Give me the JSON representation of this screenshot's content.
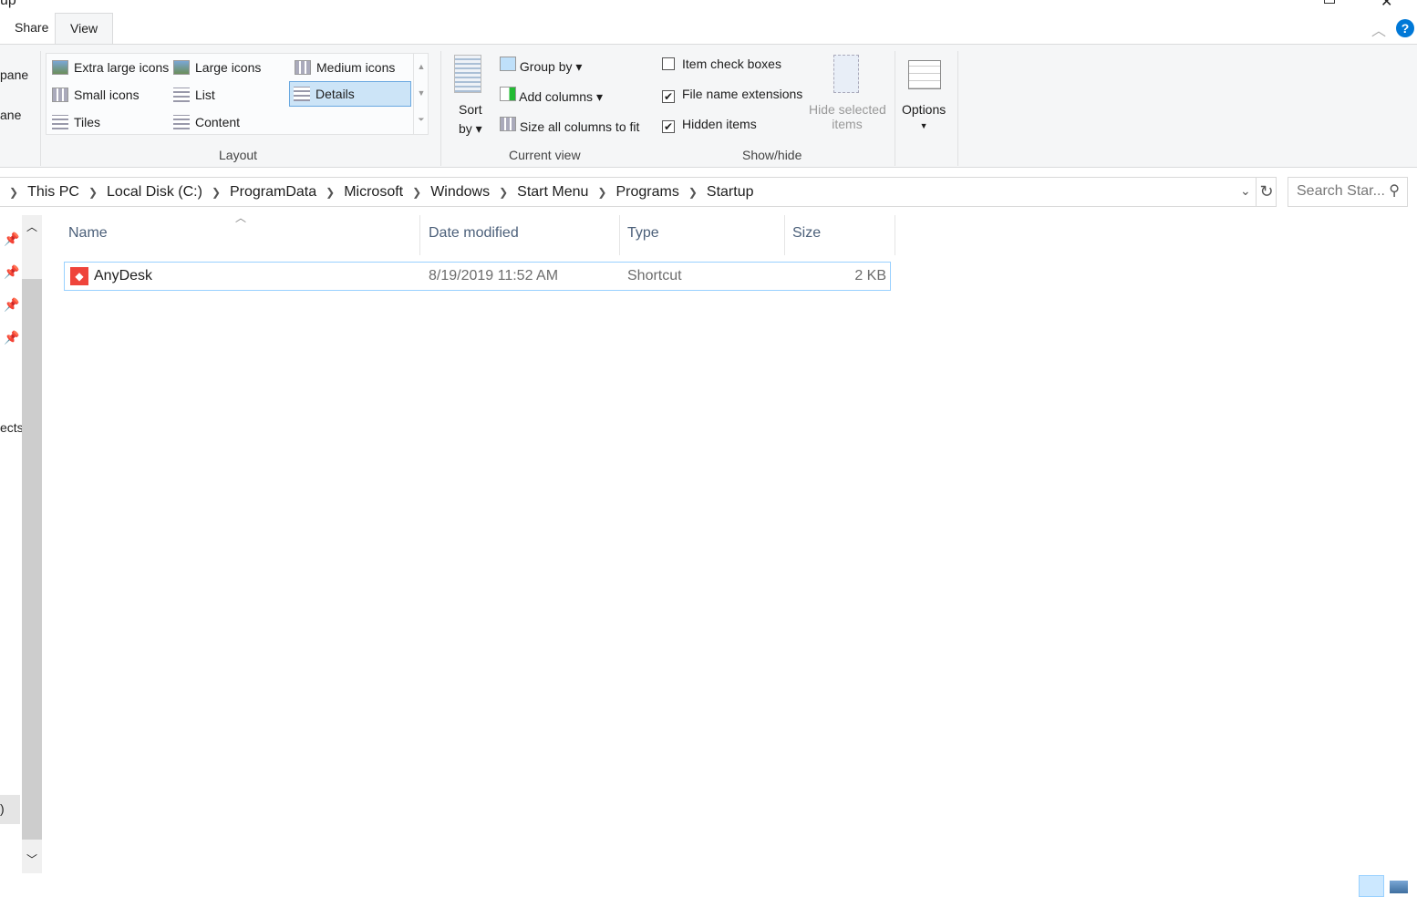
{
  "window": {
    "title_partial": "up"
  },
  "tabs": [
    {
      "label": "Share"
    },
    {
      "label": "View",
      "active": true
    }
  ],
  "nav_pane_partial": {
    "preview": "pane",
    "details": "ane",
    "objects": "ects",
    "bottom": ")"
  },
  "ribbon": {
    "layout": {
      "group_label": "Layout",
      "items": [
        {
          "label": "Extra large icons"
        },
        {
          "label": "Large icons"
        },
        {
          "label": "Medium icons"
        },
        {
          "label": "Small icons"
        },
        {
          "label": "List"
        },
        {
          "label": "Details",
          "selected": true
        },
        {
          "label": "Tiles"
        },
        {
          "label": "Content"
        }
      ]
    },
    "current_view": {
      "group_label": "Current view",
      "sort_by": "Sort",
      "sort_by2": "by",
      "group_by": "Group by",
      "add_columns": "Add columns",
      "size_columns": "Size all columns to fit"
    },
    "show_hide": {
      "group_label": "Show/hide",
      "item_check_boxes": {
        "label": "Item check boxes",
        "checked": false
      },
      "file_name_extensions": {
        "label": "File name extensions",
        "checked": true
      },
      "hidden_items": {
        "label": "Hidden items",
        "checked": true
      },
      "hide_selected": "Hide selected",
      "hide_selected2": "items"
    },
    "options": "Options"
  },
  "breadcrumb": [
    "This PC",
    "Local Disk (C:)",
    "ProgramData",
    "Microsoft",
    "Windows",
    "Start Menu",
    "Programs",
    "Startup"
  ],
  "search": {
    "placeholder": "Search Star..."
  },
  "columns": {
    "name": "Name",
    "date": "Date modified",
    "type": "Type",
    "size": "Size"
  },
  "files": [
    {
      "name": "AnyDesk",
      "date": "8/19/2019 11:52 AM",
      "type": "Shortcut",
      "size": "2 KB",
      "selected": true
    }
  ],
  "colors": {
    "accent": "#0078d7",
    "selection_border": "#99d1ff",
    "ribbon_bg": "#f5f6f7",
    "anydesk": "#ef443b"
  }
}
